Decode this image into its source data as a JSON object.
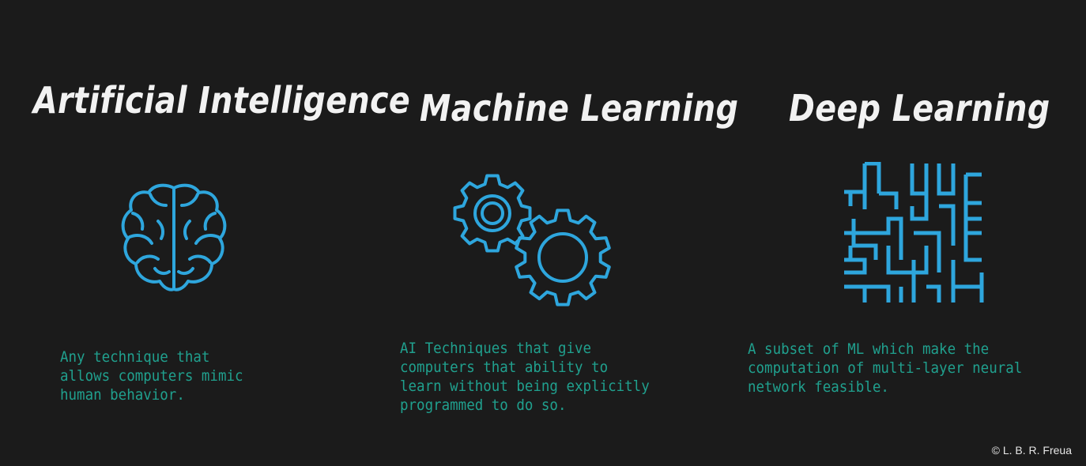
{
  "columns": [
    {
      "title": "Artificial Intelligence",
      "icon": "brain-icon",
      "description": "Any technique that\nallows computers mimic\nhuman behavior."
    },
    {
      "title": "Machine Learning",
      "icon": "gears-icon",
      "description": "AI Techniques that give\ncomputers that ability to\nlearn without being explicitly\nprogrammed to do so."
    },
    {
      "title": "Deep Learning",
      "icon": "circuit-icon",
      "description": "A subset of ML which make the\ncomputation of multi-layer neural\nnetwork feasible."
    }
  ],
  "credit": "© L. B. R. Freua",
  "colors": {
    "background": "#1b1b1b",
    "title": "#f2f2f2",
    "icon": "#2ea6dd",
    "description": "#20a08e",
    "credit": "#e6e6e6"
  }
}
